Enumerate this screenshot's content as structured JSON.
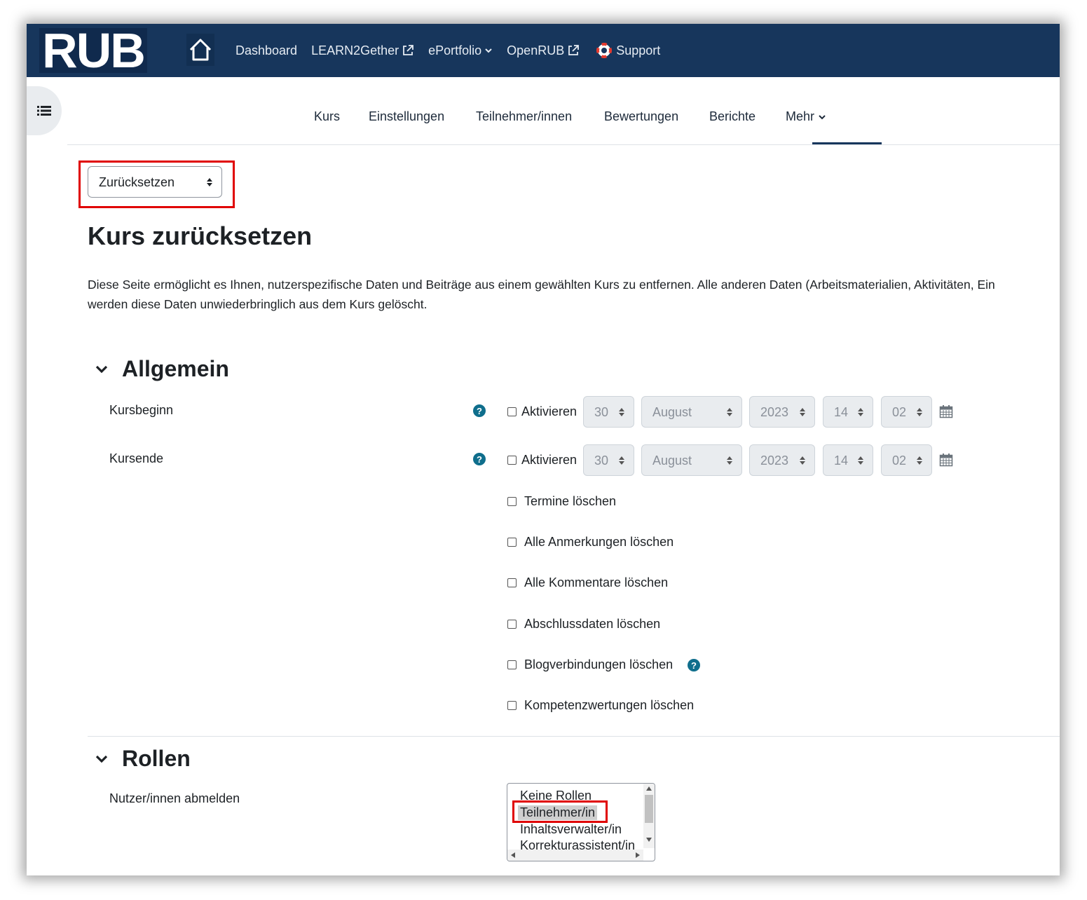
{
  "navbar": {
    "logo": "RUB",
    "links": {
      "dashboard": "Dashboard",
      "learn2gether": "LEARN2Gether",
      "eportfolio": "ePortfolio",
      "openrub": "OpenRUB",
      "support": "Support"
    }
  },
  "secondary_nav": {
    "kurs": "Kurs",
    "einstellungen": "Einstellungen",
    "teilnehmer": "Teilnehmer/innen",
    "bewertungen": "Bewertungen",
    "berichte": "Berichte",
    "mehr": "Mehr",
    "active": "Mehr"
  },
  "page_select": {
    "value": "Zurücksetzen"
  },
  "page": {
    "title": "Kurs zurücksetzen",
    "intro_line1": "Diese Seite ermöglicht es Ihnen, nutzerspezifische Daten und Beiträge aus einem gewählten Kurs zu entfernen. Alle anderen Daten (Arbeitsmaterialien, Aktivitäten, Ein",
    "intro_line2": "werden diese Daten unwiederbringlich aus dem Kurs gelöscht."
  },
  "allgemein": {
    "heading": "Allgemein",
    "kursbeginn": {
      "label": "Kursbeginn",
      "enable": "Aktivieren",
      "day": "30",
      "month": "August",
      "year": "2023",
      "hour": "14",
      "minute": "02"
    },
    "kursende": {
      "label": "Kursende",
      "enable": "Aktivieren",
      "day": "30",
      "month": "August",
      "year": "2023",
      "hour": "14",
      "minute": "02"
    },
    "options": {
      "termine": "Termine löschen",
      "anmerkungen": "Alle Anmerkungen löschen",
      "kommentare": "Alle Kommentare löschen",
      "abschluss": "Abschlussdaten löschen",
      "blog": "Blogverbindungen löschen",
      "kompetenz": "Kompetenzwertungen löschen"
    }
  },
  "rollen": {
    "heading": "Rollen",
    "label": "Nutzer/innen abmelden",
    "options": [
      "Keine Rollen",
      "Teilnehmer/in",
      "Inhaltsverwalter/in",
      "Korrekturassistent/in"
    ],
    "selected": "Teilnehmer/in"
  },
  "colors": {
    "navbar": "#17365c",
    "highlight": "#e00000",
    "help": "#0f6e8c"
  }
}
